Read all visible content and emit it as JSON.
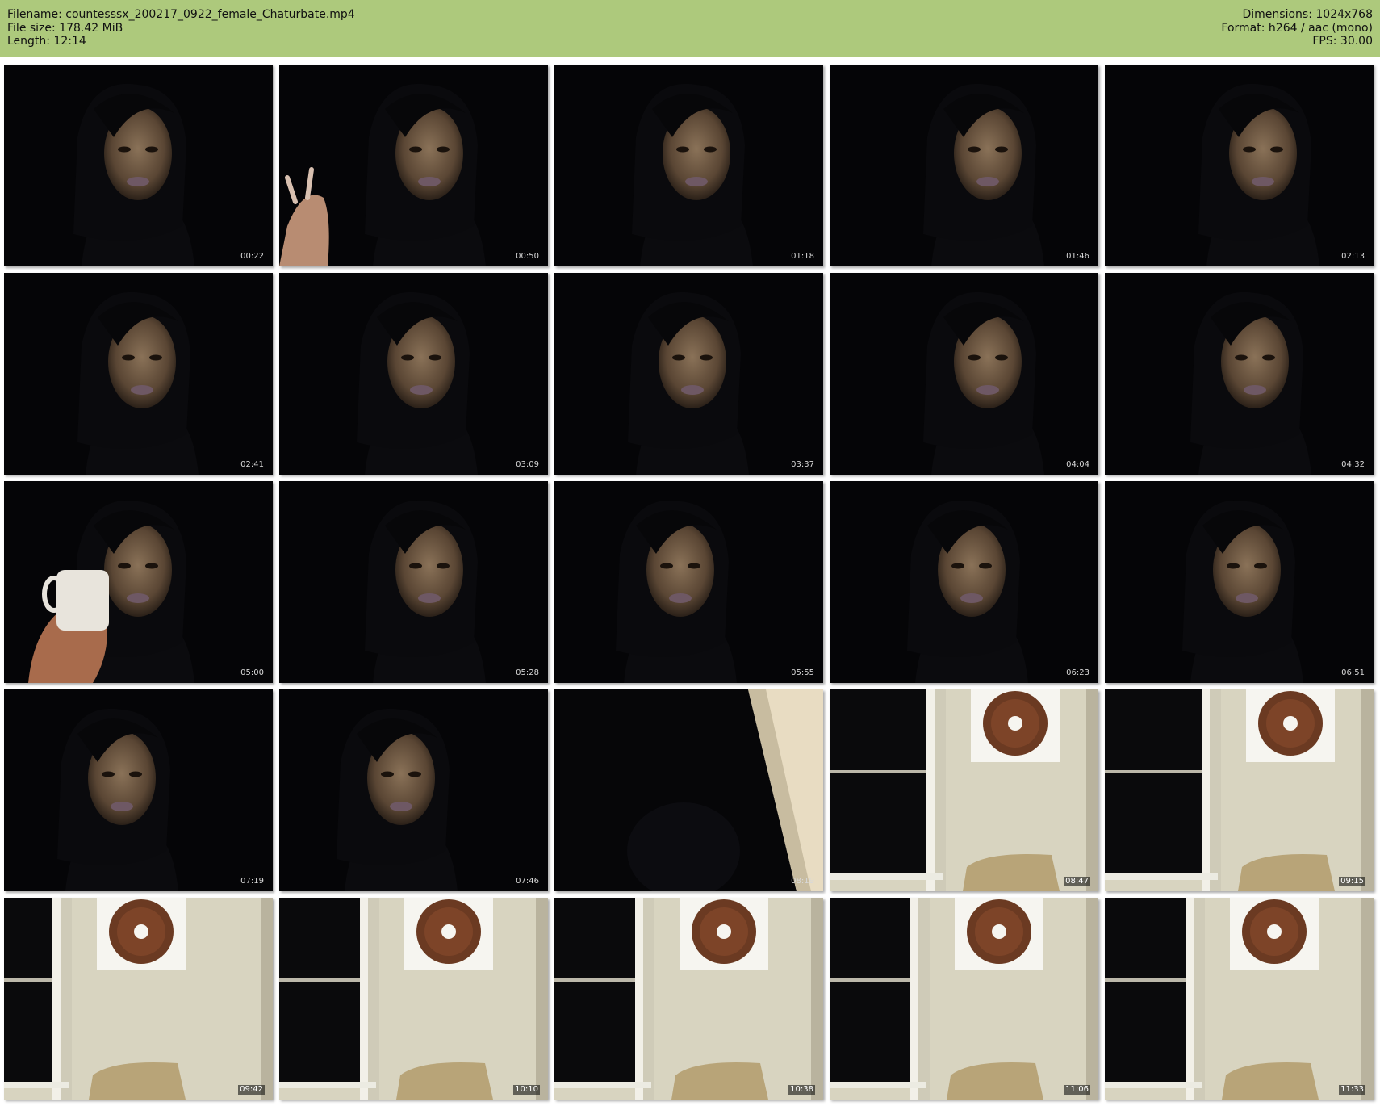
{
  "header": {
    "filename_line": "Filename: countesssx_200217_0922_female_Chaturbate.mp4",
    "filesize_line": "File size: 178.42 MiB",
    "length_line": "Length: 12:14",
    "dimensions_line": "Dimensions: 1024x768",
    "format_line": "Format: h264 / aac (mono)",
    "fps_line": "FPS: 30.00",
    "background_color": "#adc97c"
  },
  "thumbnails": [
    {
      "time": "00:22",
      "scene": "webcam-portrait"
    },
    {
      "time": "00:50",
      "scene": "webcam-portrait-hand"
    },
    {
      "time": "01:18",
      "scene": "webcam-portrait"
    },
    {
      "time": "01:46",
      "scene": "webcam-portrait"
    },
    {
      "time": "02:13",
      "scene": "webcam-portrait"
    },
    {
      "time": "02:41",
      "scene": "webcam-portrait"
    },
    {
      "time": "03:09",
      "scene": "webcam-portrait"
    },
    {
      "time": "03:37",
      "scene": "webcam-portrait"
    },
    {
      "time": "04:04",
      "scene": "webcam-portrait"
    },
    {
      "time": "04:32",
      "scene": "webcam-portrait"
    },
    {
      "time": "05:00",
      "scene": "webcam-portrait-mug"
    },
    {
      "time": "05:28",
      "scene": "webcam-portrait"
    },
    {
      "time": "05:55",
      "scene": "webcam-portrait"
    },
    {
      "time": "06:23",
      "scene": "webcam-portrait"
    },
    {
      "time": "06:51",
      "scene": "webcam-portrait"
    },
    {
      "time": "07:19",
      "scene": "webcam-portrait"
    },
    {
      "time": "07:46",
      "scene": "webcam-portrait"
    },
    {
      "time": "08:19",
      "scene": "dark-doorway"
    },
    {
      "time": "08:47",
      "scene": "room-donut-art"
    },
    {
      "time": "09:15",
      "scene": "room-donut-art"
    },
    {
      "time": "09:42",
      "scene": "room-donut-art"
    },
    {
      "time": "10:10",
      "scene": "room-donut-art"
    },
    {
      "time": "10:38",
      "scene": "room-donut-art"
    },
    {
      "time": "11:06",
      "scene": "room-donut-art"
    },
    {
      "time": "11:33",
      "scene": "room-donut-art"
    }
  ]
}
